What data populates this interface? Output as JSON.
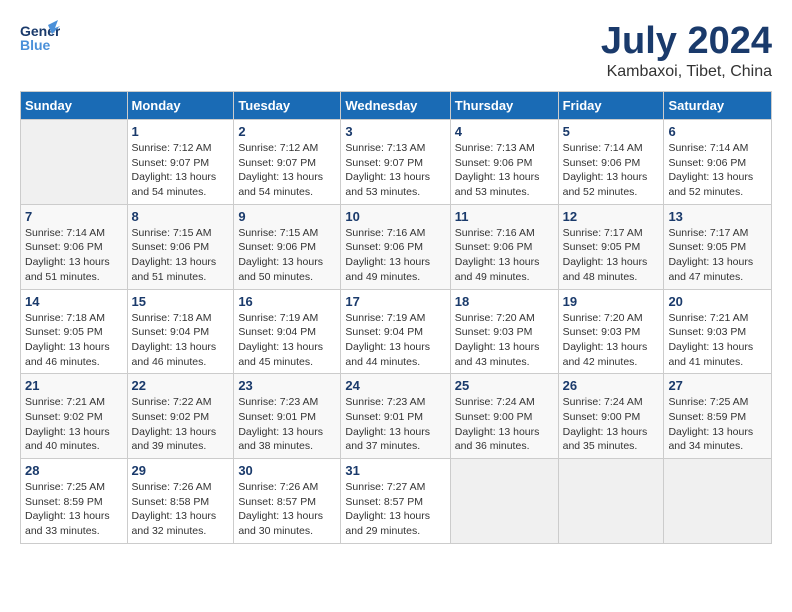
{
  "header": {
    "logo_general": "General",
    "logo_blue": "Blue",
    "month": "July 2024",
    "location": "Kambaxoi, Tibet, China"
  },
  "weekdays": [
    "Sunday",
    "Monday",
    "Tuesday",
    "Wednesday",
    "Thursday",
    "Friday",
    "Saturday"
  ],
  "weeks": [
    [
      {
        "day": "",
        "empty": true
      },
      {
        "day": "1",
        "sunrise": "Sunrise: 7:12 AM",
        "sunset": "Sunset: 9:07 PM",
        "daylight": "Daylight: 13 hours and 54 minutes."
      },
      {
        "day": "2",
        "sunrise": "Sunrise: 7:12 AM",
        "sunset": "Sunset: 9:07 PM",
        "daylight": "Daylight: 13 hours and 54 minutes."
      },
      {
        "day": "3",
        "sunrise": "Sunrise: 7:13 AM",
        "sunset": "Sunset: 9:07 PM",
        "daylight": "Daylight: 13 hours and 53 minutes."
      },
      {
        "day": "4",
        "sunrise": "Sunrise: 7:13 AM",
        "sunset": "Sunset: 9:06 PM",
        "daylight": "Daylight: 13 hours and 53 minutes."
      },
      {
        "day": "5",
        "sunrise": "Sunrise: 7:14 AM",
        "sunset": "Sunset: 9:06 PM",
        "daylight": "Daylight: 13 hours and 52 minutes."
      },
      {
        "day": "6",
        "sunrise": "Sunrise: 7:14 AM",
        "sunset": "Sunset: 9:06 PM",
        "daylight": "Daylight: 13 hours and 52 minutes."
      }
    ],
    [
      {
        "day": "7",
        "sunrise": "Sunrise: 7:14 AM",
        "sunset": "Sunset: 9:06 PM",
        "daylight": "Daylight: 13 hours and 51 minutes."
      },
      {
        "day": "8",
        "sunrise": "Sunrise: 7:15 AM",
        "sunset": "Sunset: 9:06 PM",
        "daylight": "Daylight: 13 hours and 51 minutes."
      },
      {
        "day": "9",
        "sunrise": "Sunrise: 7:15 AM",
        "sunset": "Sunset: 9:06 PM",
        "daylight": "Daylight: 13 hours and 50 minutes."
      },
      {
        "day": "10",
        "sunrise": "Sunrise: 7:16 AM",
        "sunset": "Sunset: 9:06 PM",
        "daylight": "Daylight: 13 hours and 49 minutes."
      },
      {
        "day": "11",
        "sunrise": "Sunrise: 7:16 AM",
        "sunset": "Sunset: 9:06 PM",
        "daylight": "Daylight: 13 hours and 49 minutes."
      },
      {
        "day": "12",
        "sunrise": "Sunrise: 7:17 AM",
        "sunset": "Sunset: 9:05 PM",
        "daylight": "Daylight: 13 hours and 48 minutes."
      },
      {
        "day": "13",
        "sunrise": "Sunrise: 7:17 AM",
        "sunset": "Sunset: 9:05 PM",
        "daylight": "Daylight: 13 hours and 47 minutes."
      }
    ],
    [
      {
        "day": "14",
        "sunrise": "Sunrise: 7:18 AM",
        "sunset": "Sunset: 9:05 PM",
        "daylight": "Daylight: 13 hours and 46 minutes."
      },
      {
        "day": "15",
        "sunrise": "Sunrise: 7:18 AM",
        "sunset": "Sunset: 9:04 PM",
        "daylight": "Daylight: 13 hours and 46 minutes."
      },
      {
        "day": "16",
        "sunrise": "Sunrise: 7:19 AM",
        "sunset": "Sunset: 9:04 PM",
        "daylight": "Daylight: 13 hours and 45 minutes."
      },
      {
        "day": "17",
        "sunrise": "Sunrise: 7:19 AM",
        "sunset": "Sunset: 9:04 PM",
        "daylight": "Daylight: 13 hours and 44 minutes."
      },
      {
        "day": "18",
        "sunrise": "Sunrise: 7:20 AM",
        "sunset": "Sunset: 9:03 PM",
        "daylight": "Daylight: 13 hours and 43 minutes."
      },
      {
        "day": "19",
        "sunrise": "Sunrise: 7:20 AM",
        "sunset": "Sunset: 9:03 PM",
        "daylight": "Daylight: 13 hours and 42 minutes."
      },
      {
        "day": "20",
        "sunrise": "Sunrise: 7:21 AM",
        "sunset": "Sunset: 9:03 PM",
        "daylight": "Daylight: 13 hours and 41 minutes."
      }
    ],
    [
      {
        "day": "21",
        "sunrise": "Sunrise: 7:21 AM",
        "sunset": "Sunset: 9:02 PM",
        "daylight": "Daylight: 13 hours and 40 minutes."
      },
      {
        "day": "22",
        "sunrise": "Sunrise: 7:22 AM",
        "sunset": "Sunset: 9:02 PM",
        "daylight": "Daylight: 13 hours and 39 minutes."
      },
      {
        "day": "23",
        "sunrise": "Sunrise: 7:23 AM",
        "sunset": "Sunset: 9:01 PM",
        "daylight": "Daylight: 13 hours and 38 minutes."
      },
      {
        "day": "24",
        "sunrise": "Sunrise: 7:23 AM",
        "sunset": "Sunset: 9:01 PM",
        "daylight": "Daylight: 13 hours and 37 minutes."
      },
      {
        "day": "25",
        "sunrise": "Sunrise: 7:24 AM",
        "sunset": "Sunset: 9:00 PM",
        "daylight": "Daylight: 13 hours and 36 minutes."
      },
      {
        "day": "26",
        "sunrise": "Sunrise: 7:24 AM",
        "sunset": "Sunset: 9:00 PM",
        "daylight": "Daylight: 13 hours and 35 minutes."
      },
      {
        "day": "27",
        "sunrise": "Sunrise: 7:25 AM",
        "sunset": "Sunset: 8:59 PM",
        "daylight": "Daylight: 13 hours and 34 minutes."
      }
    ],
    [
      {
        "day": "28",
        "sunrise": "Sunrise: 7:25 AM",
        "sunset": "Sunset: 8:59 PM",
        "daylight": "Daylight: 13 hours and 33 minutes."
      },
      {
        "day": "29",
        "sunrise": "Sunrise: 7:26 AM",
        "sunset": "Sunset: 8:58 PM",
        "daylight": "Daylight: 13 hours and 32 minutes."
      },
      {
        "day": "30",
        "sunrise": "Sunrise: 7:26 AM",
        "sunset": "Sunset: 8:57 PM",
        "daylight": "Daylight: 13 hours and 30 minutes."
      },
      {
        "day": "31",
        "sunrise": "Sunrise: 7:27 AM",
        "sunset": "Sunset: 8:57 PM",
        "daylight": "Daylight: 13 hours and 29 minutes."
      },
      {
        "day": "",
        "empty": true
      },
      {
        "day": "",
        "empty": true
      },
      {
        "day": "",
        "empty": true
      }
    ]
  ]
}
